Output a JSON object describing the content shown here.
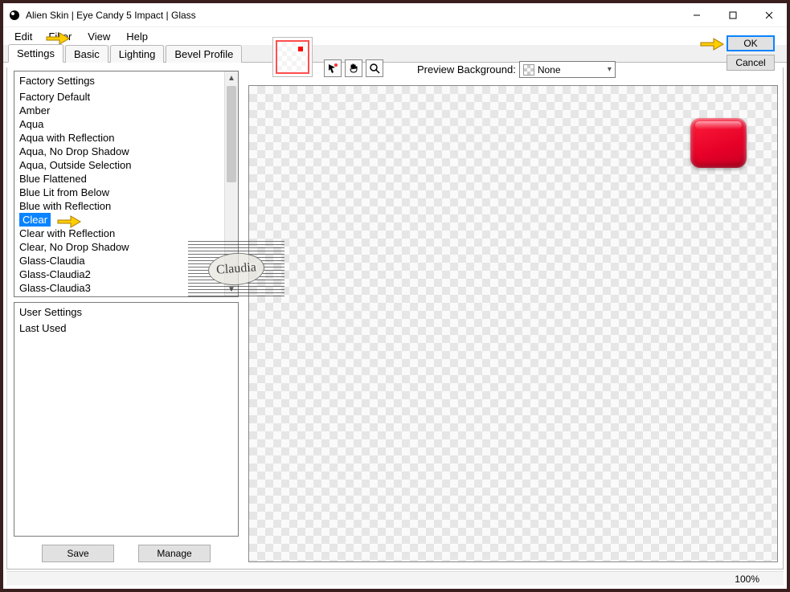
{
  "window": {
    "title": "Alien Skin | Eye Candy 5 Impact | Glass"
  },
  "menubar": {
    "items": [
      "Edit",
      "Filter",
      "View",
      "Help"
    ]
  },
  "tabs": {
    "items": [
      "Settings",
      "Basic",
      "Lighting",
      "Bevel Profile"
    ],
    "active_index": 0
  },
  "factory_settings": {
    "header": "Factory Settings",
    "items": [
      "Factory Default",
      "Amber",
      "Aqua",
      "Aqua with Reflection",
      "Aqua, No Drop Shadow",
      "Aqua, Outside Selection",
      "Blue Flattened",
      "Blue Lit from Below",
      "Blue with Reflection",
      "Clear",
      "Clear with Reflection",
      "Clear, No Drop Shadow",
      "Glass-Claudia",
      "Glass-Claudia2",
      "Glass-Claudia3"
    ],
    "selected_index": 9
  },
  "user_settings": {
    "header": "User Settings",
    "items": [
      "Last Used"
    ]
  },
  "buttons": {
    "save": "Save",
    "manage": "Manage",
    "ok": "OK",
    "cancel": "Cancel"
  },
  "preview": {
    "label": "Preview Background:",
    "selected": "None"
  },
  "status": {
    "zoom": "100%"
  },
  "watermark": {
    "text": "Claudia"
  }
}
